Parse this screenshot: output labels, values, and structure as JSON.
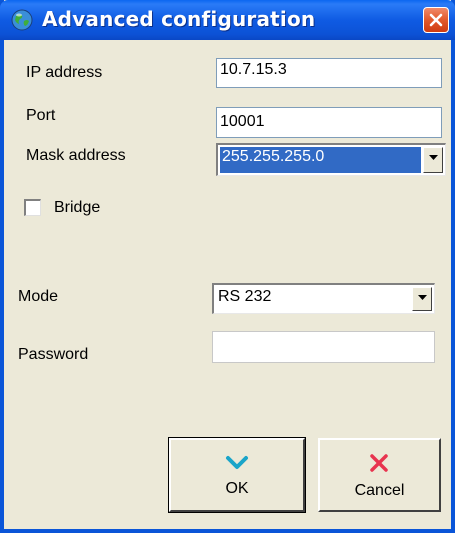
{
  "window": {
    "title": "Advanced configuration",
    "icon": "globe-icon",
    "close_icon": "close-icon"
  },
  "fields": {
    "ip_address": {
      "label": "IP address",
      "value": "10.7.15.3"
    },
    "port": {
      "label": "Port",
      "value": "10001"
    },
    "mask_address": {
      "label": "Mask address",
      "value": "255.255.255.0"
    },
    "bridge": {
      "label": "Bridge",
      "checked": false
    },
    "mode": {
      "label": "Mode",
      "value": "RS 232"
    },
    "password": {
      "label": "Password",
      "value": ""
    }
  },
  "buttons": {
    "ok": {
      "label": "OK",
      "icon": "checkmark-icon"
    },
    "cancel": {
      "label": "Cancel",
      "icon": "x-mark-icon"
    }
  },
  "colors": {
    "titlebar": "#0c52d6",
    "selection": "#316ac5",
    "ok_icon": "#1aa5c9",
    "cancel_icon": "#e8344f"
  }
}
